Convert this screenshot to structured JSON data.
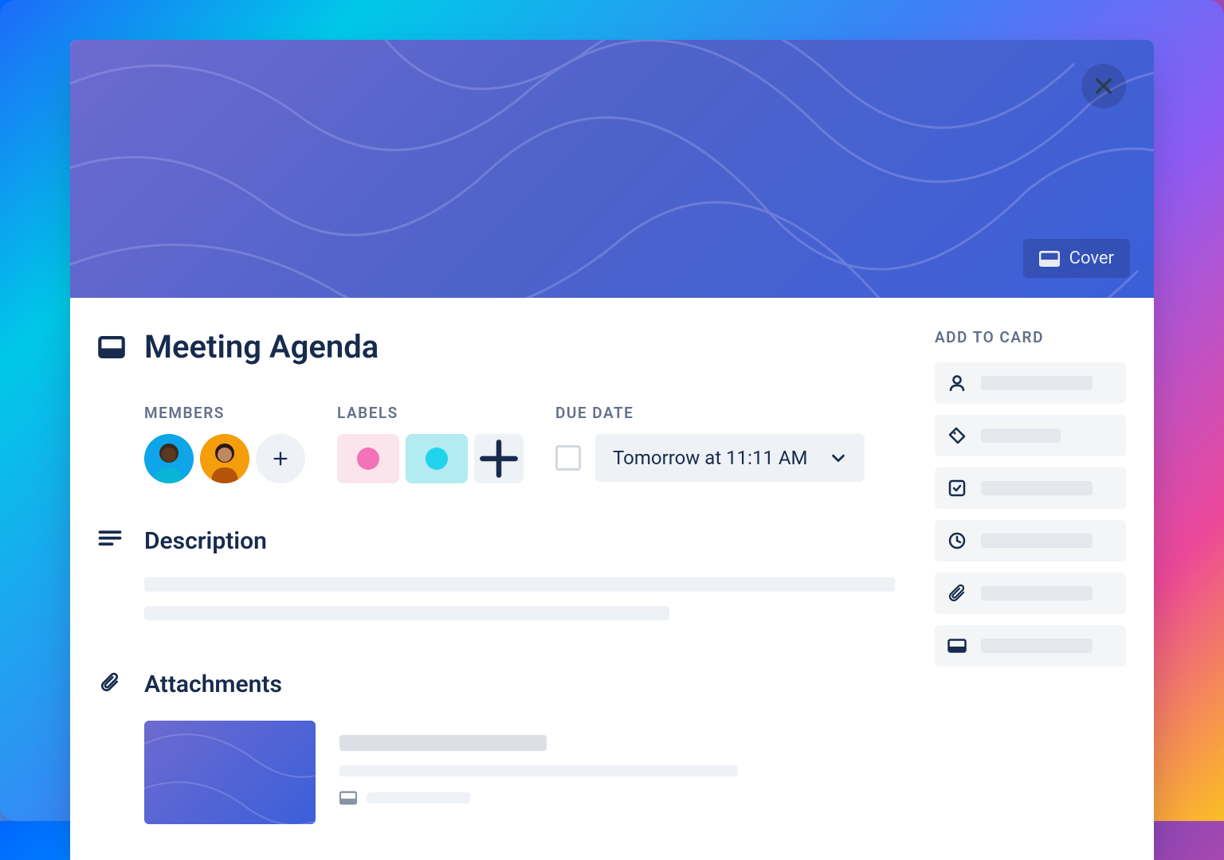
{
  "card": {
    "title": "Meeting Agenda",
    "cover_button_label": "Cover"
  },
  "meta": {
    "members_label": "MEMBERS",
    "labels_label": "LABELS",
    "due_date_label": "DUE DATE",
    "due_date_value": "Tomorrow at 11:11 AM"
  },
  "sections": {
    "description_title": "Description",
    "attachments_title": "Attachments"
  },
  "sidebar": {
    "add_to_card_label": "ADD TO CARD",
    "items": [
      {
        "icon": "user"
      },
      {
        "icon": "tag"
      },
      {
        "icon": "checklist"
      },
      {
        "icon": "clock"
      },
      {
        "icon": "attachment"
      },
      {
        "icon": "cover"
      }
    ]
  },
  "members": [
    {
      "color": "cyan"
    },
    {
      "color": "amber"
    }
  ],
  "labels": [
    {
      "color": "pink"
    },
    {
      "color": "cyan"
    }
  ]
}
